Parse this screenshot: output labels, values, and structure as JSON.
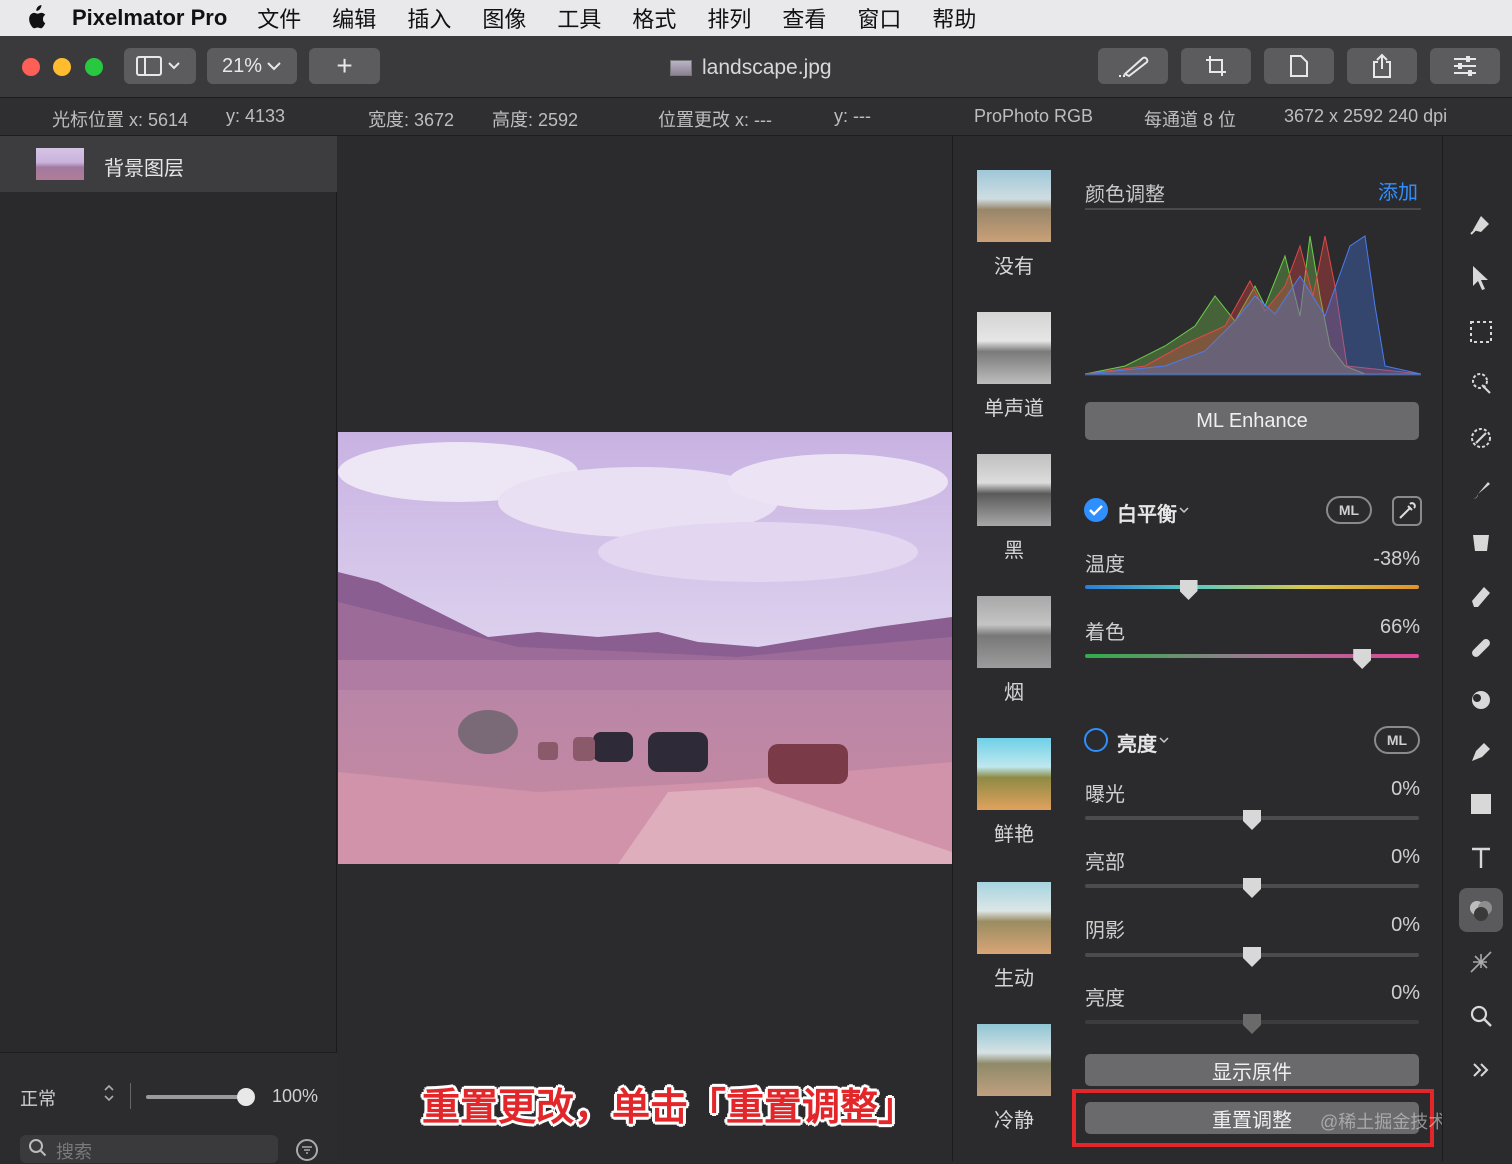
{
  "menubar": {
    "app_name": "Pixelmator Pro",
    "items": [
      "文件",
      "编辑",
      "插入",
      "图像",
      "工具",
      "格式",
      "排列",
      "查看",
      "窗口",
      "帮助"
    ]
  },
  "toolbar": {
    "zoom": "21%",
    "add_label": "+",
    "document_title": "landscape.jpg"
  },
  "infobar": {
    "cursor_x": "光标位置 x:  5614",
    "cursor_y": "y:  4133",
    "width": "宽度:  3672",
    "height": "高度:  2592",
    "pos_change_x": "位置更改 x:  ---",
    "pos_change_y": "y:  ---",
    "color_profile": "ProPhoto RGB",
    "bit_depth": "每通道 8 位",
    "resolution": "3672 x 2592 240 dpi"
  },
  "layers": {
    "layer_name": "背景图层",
    "blend_mode": "正常",
    "opacity": "100%",
    "opacity_fraction": 1.0,
    "search_placeholder": "搜索"
  },
  "caption": "重置更改，单击「重置调整」",
  "presets": [
    {
      "label": "没有"
    },
    {
      "label": "单声道"
    },
    {
      "label": "黑"
    },
    {
      "label": "烟"
    },
    {
      "label": "鲜艳"
    },
    {
      "label": "生动"
    },
    {
      "label": "冷静"
    }
  ],
  "adjustments": {
    "title": "颜色调整",
    "add_label": "添加",
    "ml_enhance": "ML Enhance",
    "white_balance": {
      "title": "白平衡",
      "enabled": true,
      "ml": "ML",
      "temperature_label": "温度",
      "temperature_value": "-38%",
      "temperature_level": -0.38,
      "tint_label": "着色",
      "tint_value": "66%",
      "tint_level": 0.66
    },
    "lightness": {
      "title": "亮度",
      "enabled": false,
      "ml": "ML",
      "rows": [
        {
          "label": "曝光",
          "value": "0%"
        },
        {
          "label": "亮部",
          "value": "0%"
        },
        {
          "label": "阴影",
          "value": "0%"
        },
        {
          "label": "亮度",
          "value": "0%"
        }
      ]
    },
    "show_original": "显示原件",
    "reset": "重置调整"
  },
  "watermark": "@稀土掘金技术社区",
  "colors": {
    "accent": "#2f8fff",
    "highlight_red": "#e2262a"
  }
}
